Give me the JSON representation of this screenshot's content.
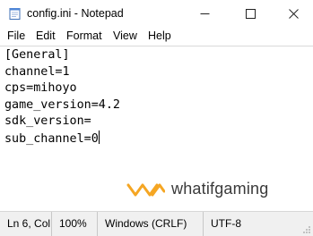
{
  "window": {
    "title": "config.ini - Notepad",
    "icon": "notepad-icon",
    "controls": {
      "minimize": "minimize-icon",
      "maximize": "maximize-icon",
      "close": "close-icon"
    }
  },
  "menu": {
    "items": [
      {
        "label": "File"
      },
      {
        "label": "Edit"
      },
      {
        "label": "Format"
      },
      {
        "label": "View"
      },
      {
        "label": "Help"
      }
    ]
  },
  "editor": {
    "lines": [
      "[General]",
      "channel=1",
      "cps=mihoyo",
      "game_version=4.2",
      "sdk_version=",
      "sub_channel=0"
    ]
  },
  "watermark": {
    "text": "whatifgaming",
    "accent_color": "#f5a623"
  },
  "status": {
    "position": "Ln 6, Col",
    "zoom": "100%",
    "line_endings": "Windows (CRLF)",
    "encoding": "UTF-8"
  }
}
